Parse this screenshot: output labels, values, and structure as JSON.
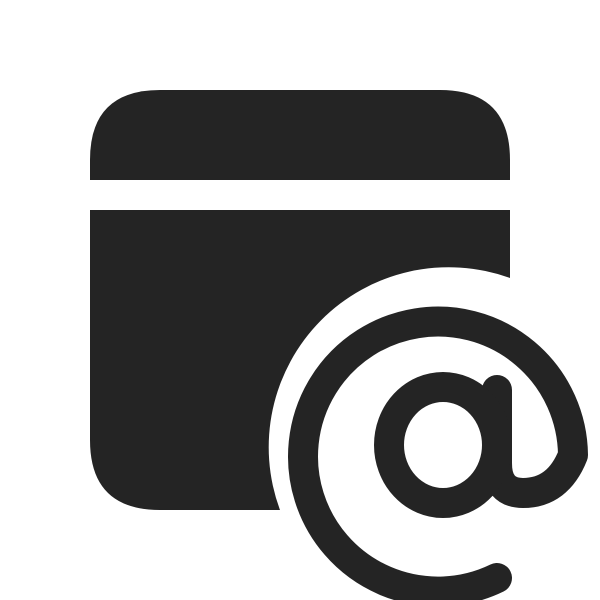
{
  "icon": {
    "name": "calendar-mention-icon",
    "fill_color": "#242424",
    "background_color": "#ffffff"
  }
}
